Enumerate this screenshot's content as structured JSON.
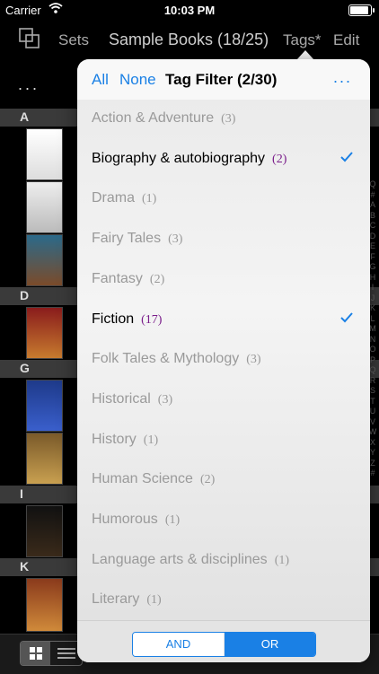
{
  "status_bar": {
    "carrier": "Carrier",
    "time": "10:03 PM"
  },
  "nav": {
    "sets": "Sets",
    "title": "Sample Books (18/25)",
    "tags": "Tags*",
    "edit": "Edit"
  },
  "list": {
    "more": "...",
    "sections": [
      "A",
      "D",
      "G",
      "I",
      "K"
    ]
  },
  "index_letters": [
    "Q",
    "#",
    "A",
    "B",
    "C",
    "D",
    "E",
    "F",
    "G",
    "H",
    "I",
    "J",
    "K",
    "L",
    "M",
    "N",
    "O",
    "P",
    "Q",
    "R",
    "S",
    "T",
    "U",
    "V",
    "W",
    "X",
    "Y",
    "Z",
    "#"
  ],
  "popover": {
    "all": "All",
    "none": "None",
    "title": "Tag Filter (2/30)",
    "more": "...",
    "tags": [
      {
        "name": "Action & Adventure",
        "count": "(3)",
        "selected": false
      },
      {
        "name": "Biography & autobiography",
        "count": "(2)",
        "selected": true
      },
      {
        "name": "Drama",
        "count": "(1)",
        "selected": false
      },
      {
        "name": "Fairy Tales",
        "count": "(3)",
        "selected": false
      },
      {
        "name": "Fantasy",
        "count": "(2)",
        "selected": false
      },
      {
        "name": "Fiction",
        "count": "(17)",
        "selected": true
      },
      {
        "name": "Folk Tales & Mythology",
        "count": "(3)",
        "selected": false
      },
      {
        "name": "Historical",
        "count": "(3)",
        "selected": false
      },
      {
        "name": "History",
        "count": "(1)",
        "selected": false
      },
      {
        "name": "Human Science",
        "count": "(2)",
        "selected": false
      },
      {
        "name": "Humorous",
        "count": "(1)",
        "selected": false
      },
      {
        "name": "Language arts & disciplines",
        "count": "(1)",
        "selected": false
      },
      {
        "name": "Literary",
        "count": "(1)",
        "selected": false
      }
    ],
    "mode": {
      "and": "AND",
      "or": "OR",
      "selected": "OR"
    }
  },
  "colors": {
    "accent": "#1a80e5",
    "count_selected": "#7a1d8a"
  }
}
